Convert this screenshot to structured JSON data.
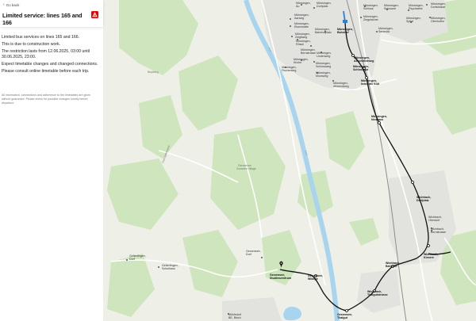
{
  "header": {
    "back_label": "Go back",
    "title": "Limited service: lines 165 and 166",
    "disruption_icon": "disruption-icon"
  },
  "body": {
    "paragraphs": [
      "Limited bus services on lines 165 and 166.",
      "This is due to construction work.",
      "The restriction lasts from 12.06.2025, 03:00 until 30.06.2025, 23:00.",
      "Expect timetable changes and changed connections.",
      "Please consult online timetable before each trip."
    ],
    "disclaimer": "All information, connections and adherence to the timetables are given without guarantee. Please check for possible changes shortly before departure."
  },
  "colors": {
    "accent": "#eb0000",
    "route": "#111111",
    "highlight_segment": "#2f7fd8",
    "river": "#a9d4ee",
    "forest": "#c9e3b6"
  },
  "map": {
    "stops": [
      {
        "name": "Münsingen, Bahnhof",
        "lines": [
          "Münsingen,",
          "Bahnhof"
        ],
        "bold": true
      },
      {
        "name": "Münsingen, Aeschiriedweg",
        "lines": [
          "Münsingen,",
          "Aeschiriedweg"
        ],
        "bold": true
      },
      {
        "name": "Münsingen, Schlossgut",
        "lines": [
          "Münsingen,",
          "Schlossgut"
        ],
        "bold": true
      },
      {
        "name": "Münsingen, Industrie Süd",
        "lines": [
          "Münsingen,",
          "Industrie Süd"
        ],
        "bold": true
      },
      {
        "name": "Münsingen, Neuhaus",
        "lines": [
          "Münsingen,",
          "Neuhaus"
        ],
        "bold": true
      },
      {
        "name": "Wichtrach, Dorfplatz",
        "lines": [
          "Wichtrach,",
          "Dorfplatz"
        ],
        "bold": true
      },
      {
        "name": "Wichtrach, Bahnhof",
        "lines": [
          "Wichtrach,",
          "Bahnhof"
        ],
        "bold": true
      },
      {
        "name": "Wichtrach, Kiesere",
        "lines": [
          "Wichtrach,",
          "Kiesere"
        ],
        "bold": true
      },
      {
        "name": "Wichtrach, Thalgutstrasse",
        "lines": [
          "Wichtrach,",
          "Thalgutstrasse"
        ],
        "bold": true
      },
      {
        "name": "Gerzensee, Thalgut",
        "lines": [
          "Gerzensee,",
          "Thalgut"
        ],
        "bold": true
      },
      {
        "name": "Gerzensee, Wiblige",
        "lines": [
          "Gerzensee,",
          "Wiblige"
        ],
        "bold": true
      },
      {
        "name": "Gerzensee, Studienzentrum",
        "lines": [
          "Gerzensee,",
          "Studienzentrum"
        ],
        "bold": true
      }
    ],
    "other_labels": [
      {
        "lines": [
          "Münsingen,",
          "Au"
        ]
      },
      {
        "lines": [
          "Münsingen,",
          "Aarweg"
        ]
      },
      {
        "lines": [
          "Münsingen,",
          "Eisenmatte"
        ]
      },
      {
        "lines": [
          "Münsingen,",
          "Zelgliweg"
        ]
      },
      {
        "lines": [
          "Münsingen,",
          "Dorfplatz"
        ]
      },
      {
        "lines": [
          "Münsingen,",
          "Schloss"
        ]
      },
      {
        "lines": [
          "Münsingen,",
          "Ziegelacher"
        ]
      },
      {
        "lines": [
          "Münsingen,",
          "Schwand"
        ]
      },
      {
        "lines": [
          "Münsingen,",
          "Psychiatrie"
        ]
      },
      {
        "lines": [
          "Münsingen,",
          "Spital"
        ]
      },
      {
        "lines": [
          "Münsingen,",
          "Senevita"
        ]
      },
      {
        "lines": [
          "Münsingen,",
          "Dorfstrasse"
        ]
      },
      {
        "lines": [
          "Münsingen,",
          "Oberhofen"
        ]
      },
      {
        "lines": [
          "Münsingen,",
          "Bahnhofplatz"
        ]
      },
      {
        "lines": [
          "Münsingen,",
          "Bernstrasse"
        ]
      },
      {
        "lines": [
          "Münsingen,",
          "Lindenweg"
        ]
      },
      {
        "lines": [
          "Münsingen,",
          "Kirche"
        ]
      },
      {
        "lines": [
          "Münsingen,",
          "Schlossweg"
        ]
      },
      {
        "lines": [
          "Münsingen,",
          "Fischerweg"
        ]
      },
      {
        "lines": [
          "Münsingen,",
          "Moosweg"
        ]
      },
      {
        "lines": [
          "Münsingen,",
          "Rössli"
        ]
      },
      {
        "lines": [
          "Münsingen,",
          "Allmendweg"
        ]
      },
      {
        "lines": [
          "Wichtrach,",
          "Oberdorf"
        ]
      },
      {
        "lines": [
          "Wichtrach,",
          "Bernstrasse"
        ]
      },
      {
        "lines": [
          "Gelterfingen,",
          "Dorf"
        ]
      },
      {
        "lines": [
          "Gelterfingen,",
          "Schulhaus"
        ]
      },
      {
        "lines": [
          "Mühledorf",
          "BE, Bisch"
        ]
      },
      {
        "lines": [
          "Gerzensee,",
          "Dorf"
        ]
      }
    ],
    "place_labels": [
      "Belpberg",
      "Gurnigelstrasse",
      "Gerzensee",
      "Gurzelen Village"
    ],
    "water_labels": [
      "Aare",
      "Aare"
    ]
  }
}
